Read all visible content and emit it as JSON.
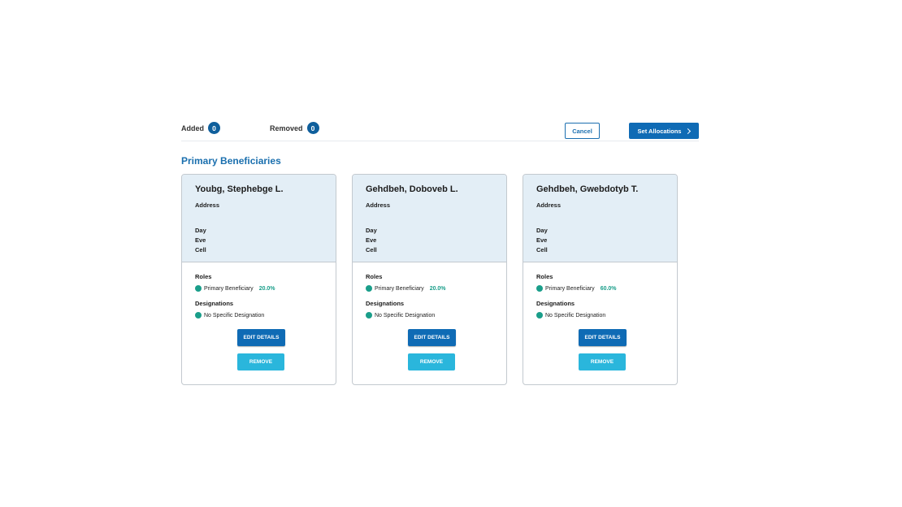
{
  "summary": {
    "added_label": "Added",
    "added_count": "0",
    "removed_label": "Removed",
    "removed_count": "0"
  },
  "actions": {
    "cancel_label": "Cancel",
    "set_allocations_label": "Set Allocations"
  },
  "section_title": "Primary Beneficiaries",
  "labels": {
    "address": "Address",
    "day": "Day",
    "eve": "Eve",
    "cell": "Cell",
    "roles": "Roles",
    "designations": "Designations",
    "edit_details": "EDIT DETAILS",
    "remove": "REMOVE"
  },
  "beneficiaries": [
    {
      "name": "Youbg, Stephebge L.",
      "role": "Primary Beneficiary",
      "percent": "20.0%",
      "designation": "No Specific Designation"
    },
    {
      "name": "Gehdbeh, Doboveb L.",
      "role": "Primary Beneficiary",
      "percent": "20.0%",
      "designation": "No Specific Designation"
    },
    {
      "name": "Gehdbeh, Gwebdotyb T.",
      "role": "Primary Beneficiary",
      "percent": "60.0%",
      "designation": "No Specific Designation"
    }
  ],
  "colors": {
    "primary": "#0f6bb5",
    "accent_teal": "#1a9e8a",
    "remove_button": "#2ab6dc",
    "card_header_bg": "#e3eef6"
  }
}
